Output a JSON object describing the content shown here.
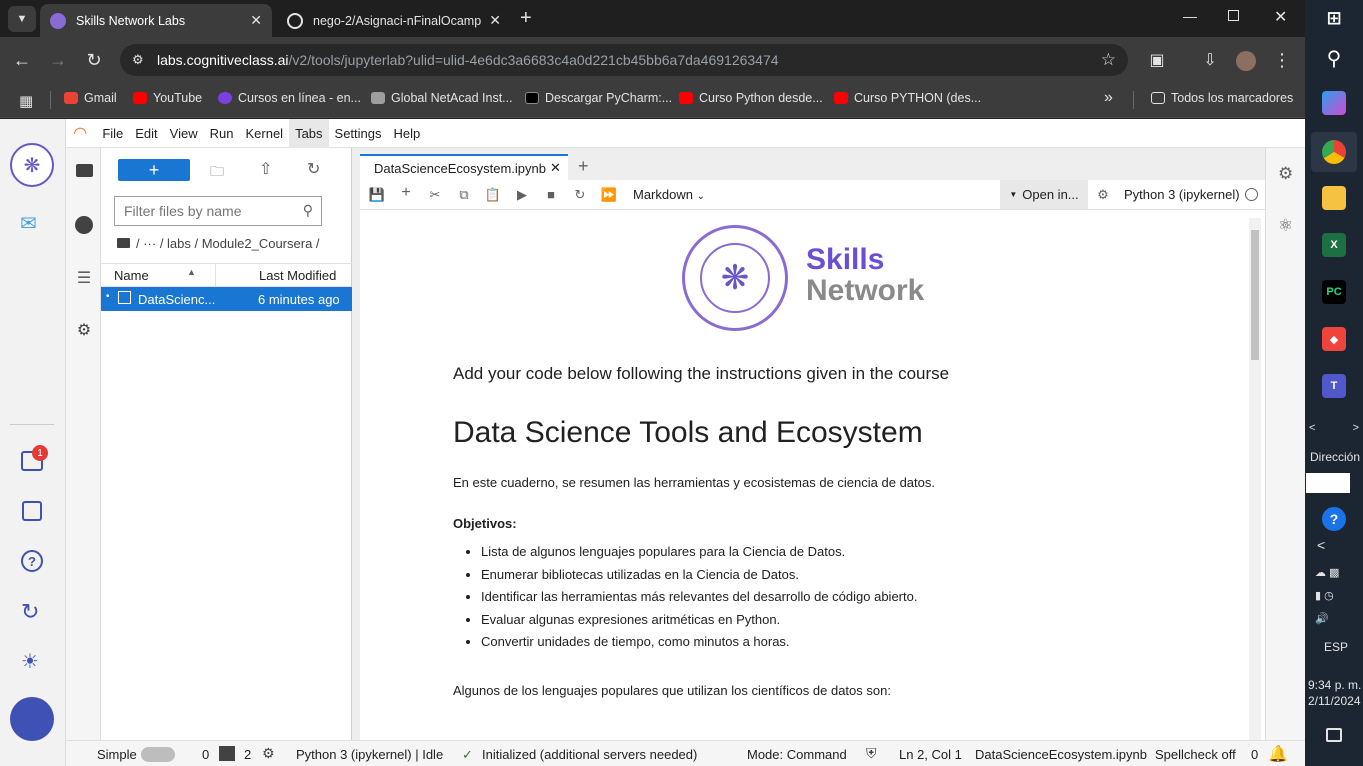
{
  "browser": {
    "tabs": [
      {
        "title": "Skills Network Labs",
        "active": true
      },
      {
        "title": "nego-2/Asignaci-nFinalOcampo",
        "active": false
      }
    ],
    "url_host": "labs.cognitiveclass.ai",
    "url_path": "/v2/tools/jupyterlab?ulid=ulid-4e6dc3a6683c4a0d221cb45bb6a7da4691263474",
    "bookmarks": [
      {
        "label": "Gmail",
        "color": "#ea4335"
      },
      {
        "label": "YouTube",
        "color": "#ff0000"
      },
      {
        "label": "Cursos en línea - en...",
        "color": "#7b3fe4"
      },
      {
        "label": "Global NetAcad Inst...",
        "color": "#9e9e9e"
      },
      {
        "label": "Descargar PyCharm:...",
        "color": "#000000"
      },
      {
        "label": "Curso Python desde...",
        "color": "#ff0000"
      },
      {
        "label": "Curso PYTHON (des...",
        "color": "#ff0000"
      }
    ],
    "bookmarks_overflow": "»",
    "all_bookmarks": "Todos los marcadores"
  },
  "jupyter": {
    "menu": [
      "File",
      "Edit",
      "View",
      "Run",
      "Kernel",
      "Tabs",
      "Settings",
      "Help"
    ],
    "filter_placeholder": "Filter files by name",
    "breadcrumb": "/   ···   / labs / Module2_Coursera /",
    "columns": {
      "name": "Name",
      "modified": "Last Modified"
    },
    "file": {
      "name": "DataScienc...",
      "modified": "6 minutes ago"
    },
    "doc_tab": "DataScienceEcosystem.ipynb",
    "cell_type": "Markdown",
    "open_in": "Open in...",
    "kernel": "Python 3 (ipykernel)",
    "notification_count": "1"
  },
  "notebook": {
    "logo_line1": "Skills",
    "logo_line2": "Network",
    "intro": "Add your code below following the instructions given in the course",
    "title": "Data Science Tools and Ecosystem",
    "summary": "En este cuaderno, se resumen las herramientas y ecosistemas de ciencia de datos.",
    "objectives_label": "Objetivos:",
    "objectives": [
      "Lista de algunos lenguajes populares para la Ciencia de Datos.",
      "Enumerar bibliotecas utilizadas en la Ciencia de Datos.",
      "Identificar las herramientas más relevantes del desarrollo de código abierto.",
      "Evaluar algunas expresiones aritméticas en Python.",
      "Convertir unidades de tiempo, como minutos a horas."
    ],
    "languages_intro": "Algunos de los lenguajes populares que utilizan los científicos de datos son:"
  },
  "statusbar": {
    "mode_simple": "Simple",
    "terminals": "0",
    "kernels": "2",
    "kernel_status": "Python 3 (ipykernel) | Idle",
    "servers": "Initialized (additional servers needed)",
    "mode": "Mode: Command",
    "position": "Ln 2, Col 1",
    "filename": "DataScienceEcosystem.ipynb",
    "spellcheck": "Spellcheck off",
    "notif": "0"
  },
  "taskbar": {
    "direccion": "Dirección",
    "lang": "ESP",
    "time": "9:34 p. m.",
    "date": "2/11/2024"
  }
}
